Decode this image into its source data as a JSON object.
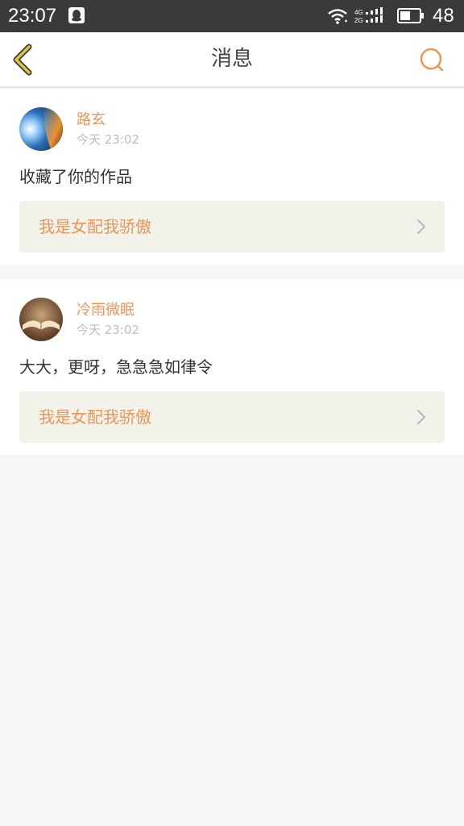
{
  "status_bar": {
    "time": "23:07",
    "battery": "48",
    "network_labels": [
      "4G",
      "2G"
    ],
    "icons": [
      "qq-icon",
      "wifi-icon",
      "signal-icon",
      "battery-icon"
    ]
  },
  "header": {
    "title": "消息",
    "back_icon": "chevron-left-icon",
    "search_icon": "search-icon"
  },
  "messages": [
    {
      "username": "路玄",
      "time": "今天 23:02",
      "text": "收藏了你的作品",
      "work_title": "我是女配我骄傲"
    },
    {
      "username": "冷雨微眠",
      "time": "今天 23:02",
      "text": "大大，更呀，急急急如律令",
      "work_title": "我是女配我骄傲"
    }
  ],
  "colors": {
    "accent": "#e8965a",
    "back_arrow": "#c9a81f",
    "status_bar": "#3a3a3a",
    "page_bg": "#f6f6f6",
    "work_link_bg": "#f2f2ea"
  }
}
